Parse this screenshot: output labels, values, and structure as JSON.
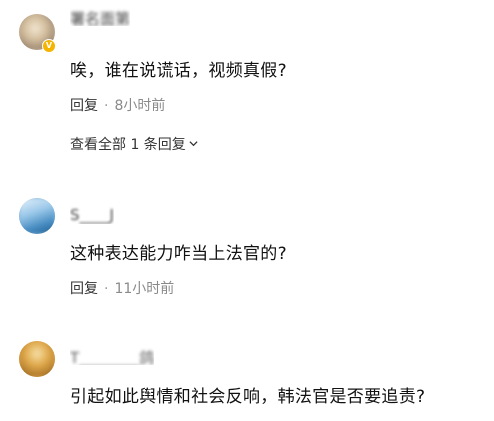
{
  "comments": [
    {
      "username": "署名面第",
      "text": "唉，谁在说谎话，视频真假?",
      "reply_label": "回复",
      "dot": "·",
      "time": "8小时前",
      "view_all": "查看全部 1 条回复"
    },
    {
      "username": "S____J",
      "text": "这种表达能力咋当上法官的?",
      "reply_label": "回复",
      "dot": "·",
      "time": "11小时前"
    },
    {
      "username": "T________鸽",
      "text": "引起如此舆情和社会反响，韩法官是否要追责?"
    }
  ],
  "icons": [
    "avatar",
    "vip-badge-icon",
    "chevron-down-icon"
  ],
  "colors": {
    "badge": "#f5b400",
    "time": "#8a8a8a",
    "text": "#111111"
  }
}
